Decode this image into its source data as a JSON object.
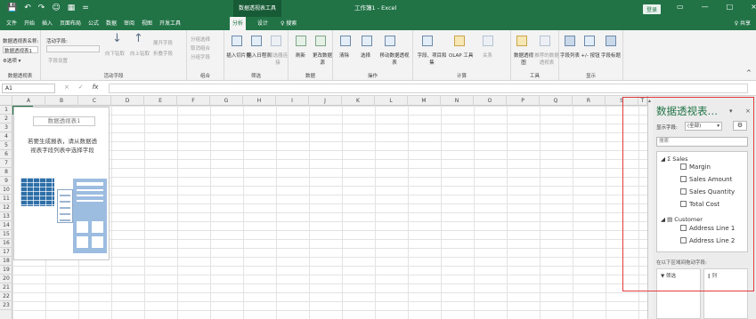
{
  "titlebar": {
    "qat": [
      "💾",
      "↶",
      "↷",
      "☺",
      "▦",
      "="
    ],
    "context_tab_group": "数据透视表工具",
    "title": "工作簿1 - Excel",
    "login": "登录",
    "window_buttons": [
      "▭",
      "—",
      "□",
      "×"
    ]
  },
  "tabs": [
    "文件",
    "开始",
    "插入",
    "页面布局",
    "公式",
    "数据",
    "审阅",
    "视图",
    "开发工具",
    "分析",
    "设计",
    "♀ 搜索"
  ],
  "active_tab": "分析",
  "share": "♀ 共享",
  "ribbon": {
    "pivot_table": {
      "name_label": "数据透视表名称:",
      "name_value": "数据透视表1",
      "options": "⚙选项 ▾",
      "group": "数据透视表"
    },
    "active_field": {
      "label": "活动字段:",
      "field_settings": "字段设置",
      "drill_down": "向下钻取",
      "drill_up": "向上钻取",
      "expand": "展开字段",
      "collapse": "折叠字段",
      "group": "活动字段"
    },
    "group_grp": {
      "sel": "分组选择",
      "ungroup": "取消组合",
      "group_field": "分组字段",
      "group": "组合"
    },
    "filter": {
      "slicer": "插入切片器",
      "timeline": "插入日程表",
      "connections": "筛选器连接",
      "group": "筛选"
    },
    "data": {
      "refresh": "刷新",
      "change_source": "更改数据源",
      "group": "数据"
    },
    "actions": {
      "clear": "清除",
      "select": "选择",
      "move": "移动数据透视表",
      "group": "操作"
    },
    "calc": {
      "fields": "字段、项目和集",
      "olap": "OLAP 工具",
      "relationships": "关系",
      "group": "计算"
    },
    "tools": {
      "chart": "数据透视图",
      "recommended": "推荐的数据透视表",
      "group": "工具"
    },
    "show": {
      "field_list": "字段列表",
      "buttons": "+/- 按钮",
      "headers": "字段标题",
      "group": "显示"
    }
  },
  "formula_bar": {
    "cell": "A1",
    "cancel": "×",
    "enter": "✓",
    "fx": "fx",
    "value": ""
  },
  "columns": [
    "A",
    "B",
    "C",
    "D",
    "E",
    "F",
    "G",
    "H",
    "I",
    "J",
    "K",
    "L",
    "M",
    "N",
    "O",
    "P",
    "Q",
    "R",
    "S",
    "T"
  ],
  "rows": [
    "1",
    "2",
    "3",
    "4",
    "5",
    "6",
    "7",
    "8",
    "9",
    "10",
    "11",
    "12",
    "13",
    "14",
    "15",
    "16",
    "17",
    "18",
    "19",
    "20",
    "21",
    "22",
    "23"
  ],
  "pivot_placeholder": {
    "title": "数据透视表1",
    "line1": "若要生成报表，请从数据透",
    "line2": "视表字段列表中选择字段"
  },
  "pane": {
    "title": "数据透视表…",
    "show_fields_label": "显示字段:",
    "show_fields_value": "(全部)",
    "search_placeholder": "搜索",
    "groups": [
      {
        "name": "Σ Sales",
        "items": [
          "Margin",
          "Sales Amount",
          "Sales Quantity",
          "Total Cost"
        ]
      },
      {
        "name": "Customer",
        "items": [
          "Address Line 1",
          "Address Line 2"
        ]
      }
    ],
    "drag_hint": "在以下区域间拖动字段:",
    "area_filter": "▼ 筛选",
    "area_columns": "‖ 列"
  }
}
